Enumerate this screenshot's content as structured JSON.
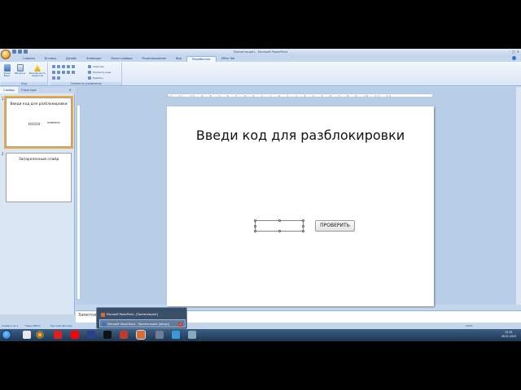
{
  "window": {
    "title": "Презентация1 - Microsoft PowerPoint",
    "controls": [
      "–",
      "□",
      "×"
    ]
  },
  "ribbon": {
    "tabs": [
      "Главная",
      "Вставка",
      "Дизайн",
      "Анимация",
      "Показ слайдов",
      "Рецензирование",
      "Вид",
      "Разработчик",
      "Office Tab"
    ],
    "active_tab": "Разработчик",
    "groups": {
      "code": {
        "label": "Код",
        "buttons": [
          "Visual Basic",
          "Макросы",
          "Безопасность макросов"
        ]
      },
      "controls": {
        "label": "Элементы управления",
        "properties": "Свойства",
        "view_code": "Просмотр кода",
        "text": "Надпись"
      }
    }
  },
  "left_pane": {
    "tabs": [
      "Слайды",
      "Структура"
    ],
    "close": "×",
    "slides": [
      {
        "number": "1",
        "title": "Введи код для разблокировки",
        "button": "ПРОВЕРИТЬ"
      },
      {
        "number": "2",
        "title": "Запароленный слайд"
      }
    ]
  },
  "ruler": {
    "ticks": "12 · 11 · 10 · 9 · 8 · 7 · 6 · 5 · 4 · 3 · 2 · 1 · 0 · 1 · 2 · 3 · 4 · 5 · 6 · 7 · 8 · 9 · 10 · 11 · 12"
  },
  "slide": {
    "title": "Введи код для разблокировки",
    "button_label": "ПРОВЕРИТЬ"
  },
  "notes": {
    "label": "Заметки"
  },
  "status": {
    "slide": "Слайд 1 из 2",
    "theme": "\"Тема Office\"",
    "language": "Русский (Россия)",
    "zoom": "102%"
  },
  "taskbar": {
    "popup_items": [
      "Microsoft PowerPoint - [Презентация1]",
      "Microsoft Visual Basic - Презентация1 [design]"
    ],
    "popup_close": "x",
    "clock_time": "15:35",
    "clock_date": "26.01.2019"
  },
  "colors": {
    "ribbon_bg": "#f2f7fd",
    "accent": "#15428b",
    "selection": "#f2a73a",
    "taskbar": "#1e3651"
  }
}
